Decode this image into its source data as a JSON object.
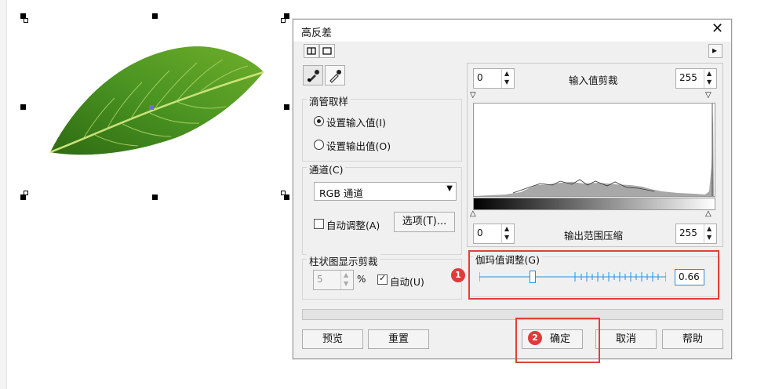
{
  "dialog": {
    "title": "高反差",
    "close_symbol": "✕"
  },
  "toolbar": {
    "split_view_icon": "split-view-icon",
    "single_view_icon": "single-view-icon",
    "expand_arrow": "▸",
    "eyedropper_input_icon": "eyedropper-icon",
    "eyedropper_output_icon": "eyedropper-icon"
  },
  "eyedropper_group": {
    "label": "滴管取样",
    "option_input": "设置输入值(I)",
    "option_output": "设置输出值(O)",
    "selected": "input"
  },
  "channel_group": {
    "label": "通道(C)",
    "selected": "RGB 通道",
    "auto_adjust_label": "自动调整(A)",
    "auto_adjust_checked": false,
    "options_button": "选项(T)..."
  },
  "histogram_clip_group": {
    "label": "柱状图显示剪裁",
    "value": "5",
    "unit": "%",
    "auto_label": "自动(U)",
    "auto_checked": true
  },
  "input_clip": {
    "label": "输入值剪裁",
    "low": "0",
    "high": "255"
  },
  "output_range": {
    "label": "输出范围压缩",
    "low": "0",
    "high": "255"
  },
  "gamma": {
    "label": "伽玛值调整(G)",
    "value": "0.66",
    "slider_fraction": 0.27
  },
  "buttons": {
    "preview": "预览",
    "reset": "重置",
    "ok": "确定",
    "cancel": "取消",
    "help": "帮助"
  },
  "annotations": {
    "badge1": "1",
    "badge2": "2",
    "highlight_color": "#e0403a"
  },
  "colors": {
    "accent": "#2a8fd6",
    "histogram_bg": "#ffffff"
  }
}
